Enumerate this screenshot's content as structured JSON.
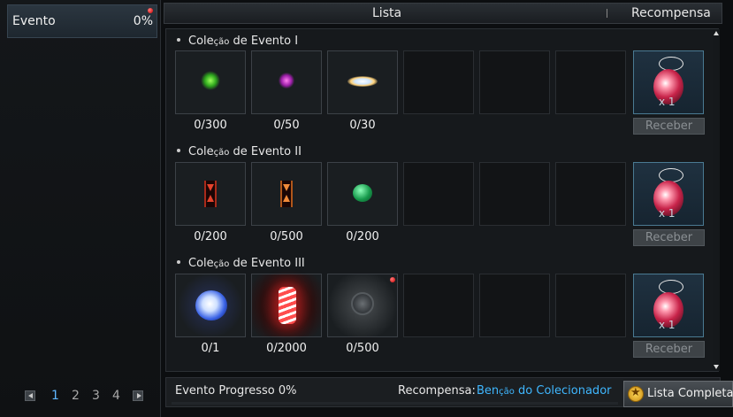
{
  "sidebar": {
    "item": {
      "label": "Evento",
      "percent": "0%"
    },
    "pager": {
      "pages": [
        "1",
        "2",
        "3",
        "4"
      ],
      "active": "1"
    }
  },
  "header": {
    "list_label": "Lista",
    "reward_label": "Recompensa"
  },
  "collections": [
    {
      "title_prefix": "Cole",
      "title_small": "ção",
      "title_suffix": " de Evento I",
      "items": [
        {
          "icon": "green-sparkle-icon",
          "count": "0/300"
        },
        {
          "icon": "purple-sparkle-icon",
          "count": "0/50"
        },
        {
          "icon": "white-light-icon",
          "count": "0/30"
        }
      ],
      "reward_qty": "x 1",
      "receive_label": "Receber"
    },
    {
      "title_prefix": "Cole",
      "title_small": "ção",
      "title_suffix": " de Evento II",
      "items": [
        {
          "icon": "red-hourglass-icon",
          "count": "0/200"
        },
        {
          "icon": "orange-hourglass-icon",
          "count": "0/500"
        },
        {
          "icon": "green-gem-icon",
          "count": "0/200"
        }
      ],
      "reward_qty": "x 1",
      "receive_label": "Receber"
    },
    {
      "title_prefix": "Cole",
      "title_small": "ção",
      "title_suffix": " de Evento III",
      "items": [
        {
          "icon": "blue-orb-icon",
          "count": "0/1"
        },
        {
          "icon": "firework-icon",
          "count": "0/2000"
        },
        {
          "icon": "compass-icon",
          "count": "0/500"
        }
      ],
      "reward_qty": "x 1",
      "receive_label": "Receber"
    }
  ],
  "footer": {
    "progress_text": "Evento Progresso 0%",
    "reward_label": "Recompensa:",
    "reward_value_prefix": "Ben",
    "reward_value_small": "ção",
    "reward_value_suffix": " do Colecionador",
    "list_button": "Lista Completa"
  },
  "colors": {
    "accent_blue": "#3fb7ff",
    "page_active": "#5fb6ff",
    "notify_red": "#d00000"
  }
}
